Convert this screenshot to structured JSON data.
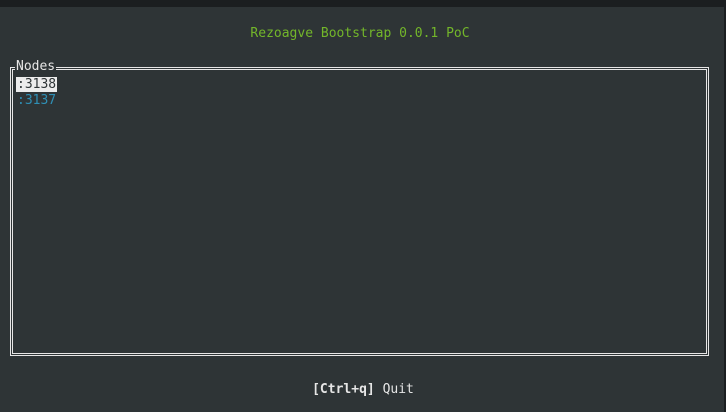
{
  "app": {
    "title": "Rezoagve Bootstrap 0.0.1 PoC"
  },
  "panel": {
    "title": "Nodes",
    "nodes": [
      {
        "label": ":3138",
        "selected": true
      },
      {
        "label": ":3137",
        "selected": false
      }
    ]
  },
  "footer": {
    "shortcut_key": "[Ctrl+q]",
    "shortcut_action": "Quit"
  },
  "colors": {
    "background": "#2e3436",
    "title": "#73b62a",
    "node_link": "#2f8fb5",
    "border": "#e6e6e6"
  }
}
